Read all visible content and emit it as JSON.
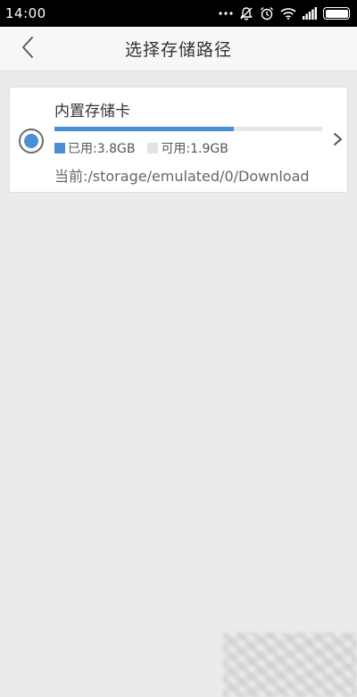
{
  "status_bar": {
    "time": "14:00",
    "icons": [
      "more-dots-icon",
      "mute-icon",
      "alarm-icon",
      "wifi-icon",
      "signal-icon",
      "battery-icon"
    ]
  },
  "header": {
    "title": "选择存储路径",
    "back_icon": "chevron-left-icon"
  },
  "storage_items": [
    {
      "name": "内置存储卡",
      "selected": true,
      "used_fraction": 0.67,
      "used_label": "已用:3.8GB",
      "free_label": "可用:1.9GB",
      "current_path": "当前:/storage/emulated/0/Download"
    }
  ],
  "colors": {
    "accent": "#4a8fd6",
    "background": "#ebebeb",
    "status_bar": "#000000",
    "free_swatch": "#e3e3e3"
  }
}
